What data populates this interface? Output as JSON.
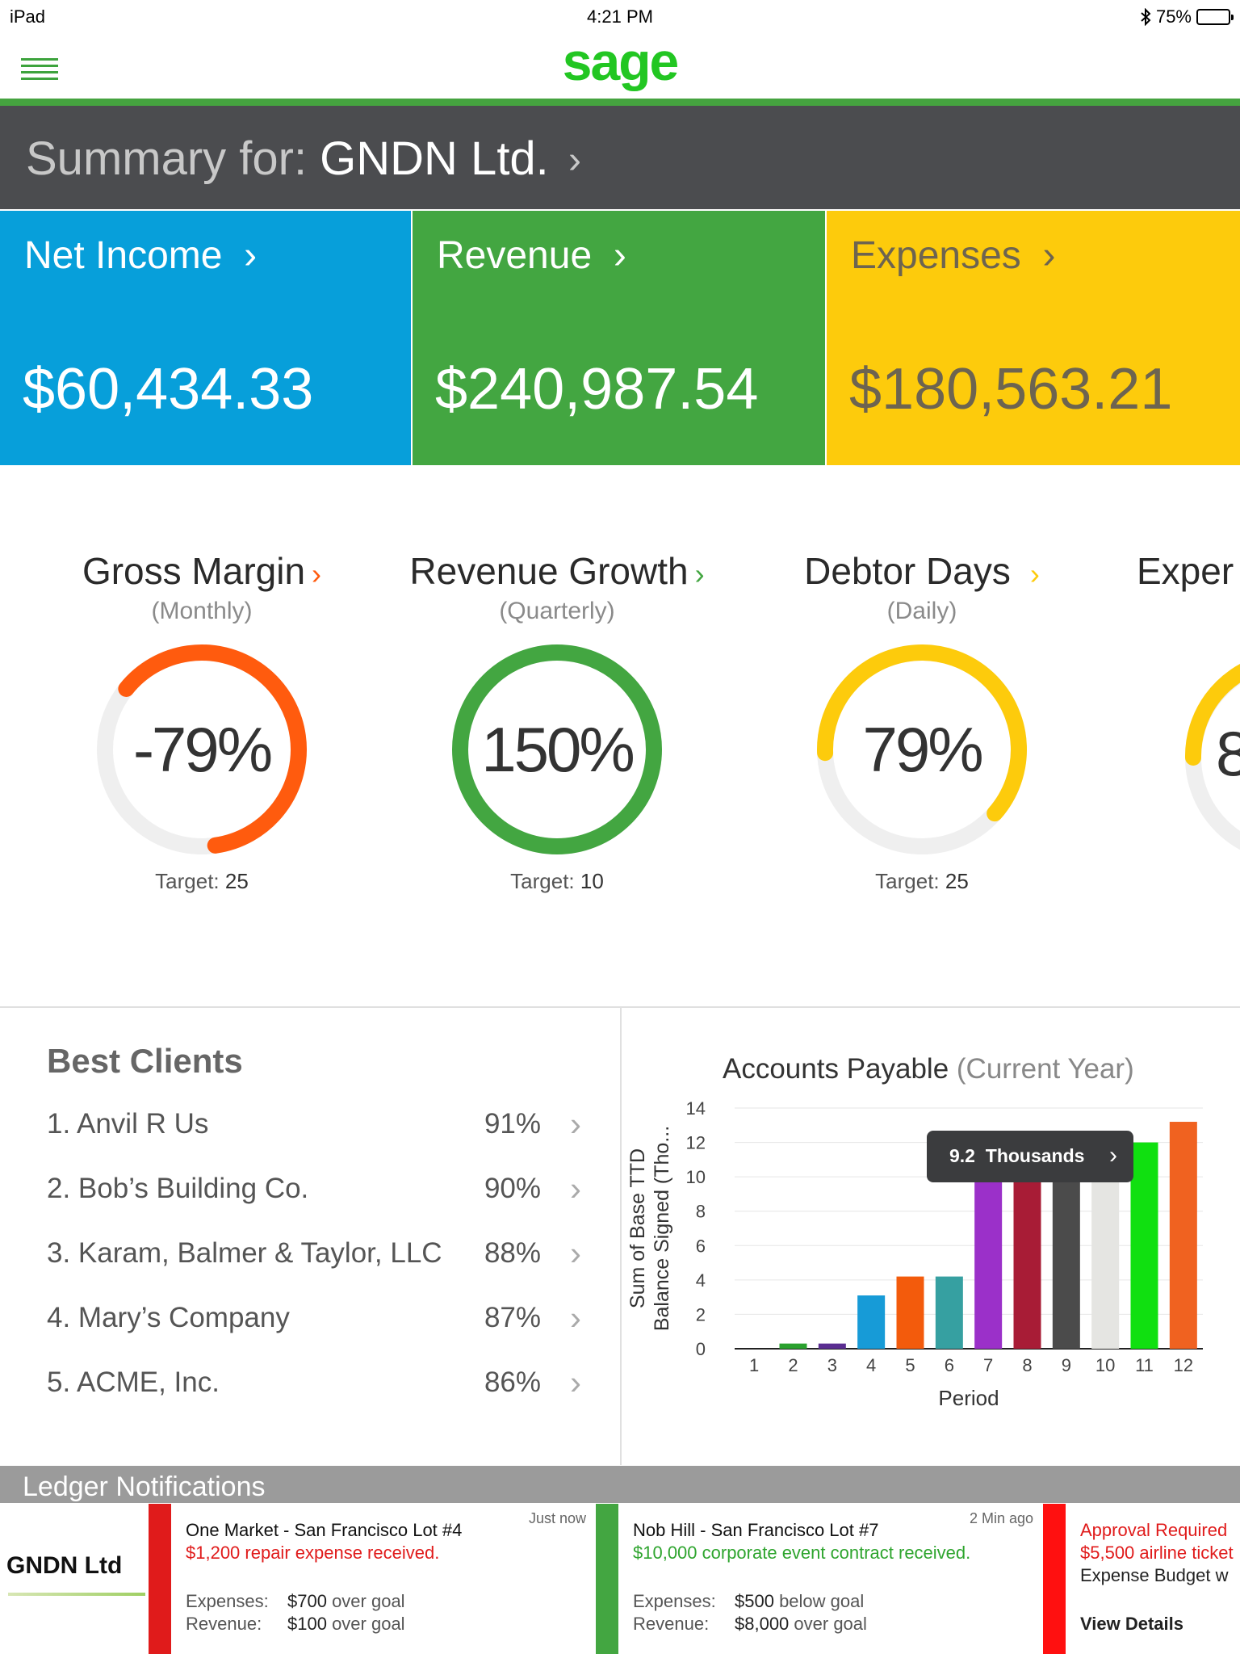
{
  "status_bar": {
    "device": "iPad",
    "time": "4:21 PM",
    "battery": "75%",
    "battery_level": 0.75
  },
  "header": {
    "logo": "sage"
  },
  "summary": {
    "label": "Summary for: ",
    "company": "GNDN Ltd."
  },
  "tiles": [
    {
      "title": "Net Income",
      "value": "$60,434.33",
      "color": "#079fda"
    },
    {
      "title": "Revenue",
      "value": "$240,987.54",
      "color": "#43a641"
    },
    {
      "title": "Expenses",
      "value": "$180,563.21",
      "color": "#fdcb0c"
    }
  ],
  "kpis": [
    {
      "title": "Gross Margin",
      "period": "(Monthly)",
      "value": "-79%",
      "target_label": "Target:",
      "target": "25",
      "color": "#ff5b0e",
      "fill": 0.62,
      "direction": "ccw"
    },
    {
      "title": "Revenue Growth",
      "period": "(Quarterly)",
      "value": "150%",
      "target_label": "Target:",
      "target": "10",
      "color": "#43a641",
      "fill": 1.0,
      "direction": "cw"
    },
    {
      "title": "Debtor Days",
      "period": "(Daily)",
      "value": "79%",
      "target_label": "Target:",
      "target": "25",
      "color": "#fdcb0c",
      "fill": 0.62,
      "direction": "cw"
    },
    {
      "title": "Exper",
      "period": "",
      "value": "8",
      "color": "#fdcb0c"
    }
  ],
  "best_clients": {
    "title": "Best Clients",
    "items": [
      {
        "name": "1. Anvil R Us",
        "pct": "91%"
      },
      {
        "name": "2. Bob’s Building Co.",
        "pct": "90%"
      },
      {
        "name": "3. Karam, Balmer & Taylor, LLC",
        "pct": "88%"
      },
      {
        "name": "4. Mary’s Company",
        "pct": "87%"
      },
      {
        "name": "5. ACME, Inc.",
        "pct": "86%"
      }
    ]
  },
  "chart_data": {
    "type": "bar",
    "title": "Accounts Payable",
    "subtitle": "(Current Year)",
    "xlabel": "Period",
    "ylabel_lines": [
      "Sum of Base TTD",
      "Balance Signed (Tho..."
    ],
    "ylim": [
      0,
      14
    ],
    "yticks": [
      0,
      2,
      4,
      6,
      8,
      10,
      12,
      14
    ],
    "categories": [
      "1",
      "2",
      "3",
      "4",
      "5",
      "6",
      "7",
      "8",
      "9",
      "10",
      "11",
      "12"
    ],
    "values": [
      0,
      0.3,
      0.3,
      3.1,
      4.2,
      4.2,
      10.8,
      10.8,
      10.8,
      10.8,
      12.0,
      13.2
    ],
    "colors": [
      "#ffffff",
      "#2aa12e",
      "#5a2d91",
      "#179bd7",
      "#f35b0c",
      "#36a0a1",
      "#9b30c9",
      "#a81c36",
      "#4b4b4b",
      "#e5e5e2",
      "#10e010",
      "#f06220"
    ],
    "tooltip": {
      "value": "9.2",
      "unit": "Thousands"
    }
  },
  "ledger": {
    "title": "Ledger Notifications",
    "logo": "GNDN Ltd",
    "notifications": [
      {
        "title": "One Market - San Francisco Lot #4",
        "message": "$1,200 repair expense received.",
        "message_color": "#e01b1b",
        "time": "Just now",
        "bar_color": "#e01b1b",
        "rows": [
          {
            "k": "Expenses:",
            "v": "$700",
            "s": " over goal"
          },
          {
            "k": "Revenue:",
            "v": "$100",
            "s": " over goal"
          }
        ]
      },
      {
        "title": "Nob Hill - San Francisco Lot #7",
        "message": "$10,000 corporate event contract received.",
        "message_color": "#2fa52f",
        "time": "2 Min ago",
        "bar_color": "#43a641",
        "rows": [
          {
            "k": "Expenses:",
            "v": "$500",
            "s": " below goal"
          },
          {
            "k": "Revenue:",
            "v": "$8,000",
            "s": " over goal"
          }
        ]
      },
      {
        "title": "Approval Required",
        "message": "$5,500 airline ticket",
        "message2": "Expense Budget w",
        "link": "View Details",
        "bar_color": "#ff1010"
      }
    ]
  }
}
